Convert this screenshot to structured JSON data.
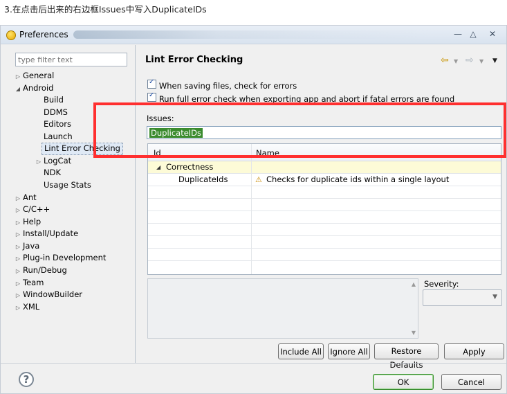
{
  "caption": "3.在点击后出来的右边框Issues中写入DuplicateIDs",
  "window": {
    "title": "Preferences",
    "min_glyph": "—",
    "max_glyph": "△",
    "close_glyph": "✕"
  },
  "filter": {
    "placeholder": "type filter text"
  },
  "tree": {
    "general": "General",
    "android": "Android",
    "build": "Build",
    "ddms": "DDMS",
    "editors": "Editors",
    "launch": "Launch",
    "lint": "Lint Error Checking",
    "logcat": "LogCat",
    "ndk": "NDK",
    "usage": "Usage Stats",
    "ant": "Ant",
    "cpp": "C/C++",
    "help": "Help",
    "install": "Install/Update",
    "java": "Java",
    "plugin": "Plug-in Development",
    "rundebug": "Run/Debug",
    "team": "Team",
    "windowbuilder": "WindowBuilder",
    "xml": "XML"
  },
  "page": {
    "title": "Lint Error Checking",
    "check1": "When saving files, check for errors",
    "check2": "Run full error check when exporting app and abort if fatal errors are found",
    "issues_label": "Issues:",
    "issues_value": "DuplicateIDs"
  },
  "table": {
    "col_id": "Id",
    "col_name": "Name",
    "category": "Correctness",
    "issue_id": "DuplicateIds",
    "issue_name": "Checks for duplicate ids within a single layout"
  },
  "severity": {
    "label": "Severity:"
  },
  "buttons": {
    "include_all": "Include All",
    "ignore_all": "Ignore All",
    "restore_defaults": "Restore Defaults",
    "apply": "Apply",
    "ok": "OK",
    "cancel": "Cancel"
  },
  "colors": {
    "selection": "#3a8b2e",
    "highlight_box": "#ff2f2f",
    "category_row": "#fdfbd7"
  }
}
